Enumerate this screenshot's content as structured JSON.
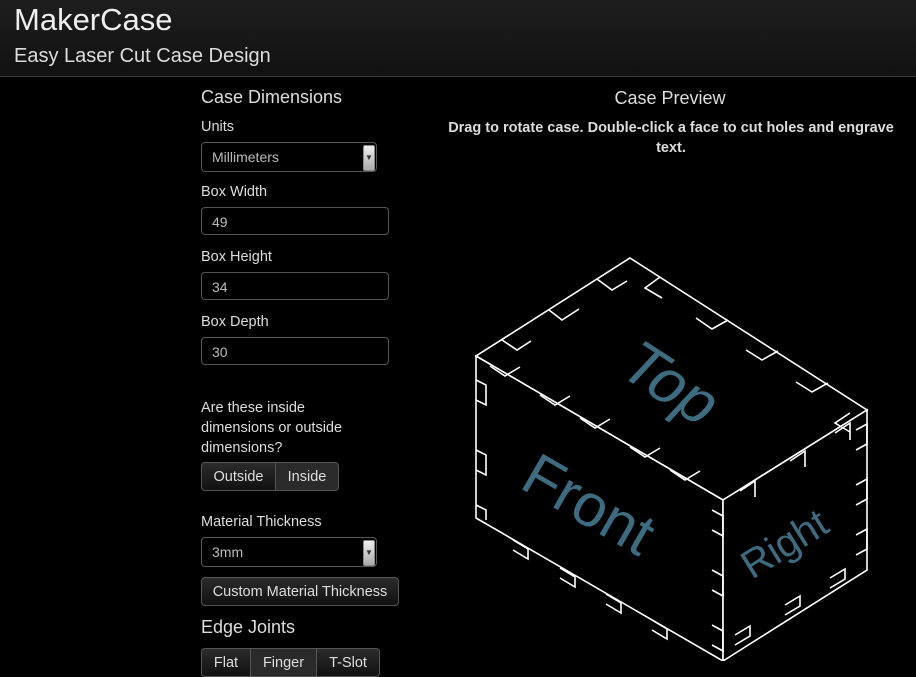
{
  "header": {
    "title": "MakerCase",
    "subtitle": "Easy Laser Cut Case Design"
  },
  "form": {
    "section_title": "Case Dimensions",
    "units_label": "Units",
    "units_value": "Millimeters",
    "width_label": "Box Width",
    "width_value": "49",
    "height_label": "Box Height",
    "height_value": "34",
    "depth_label": "Box Depth",
    "depth_value": "30",
    "inside_question": "Are these inside dimensions or outside dimensions?",
    "outside_label": "Outside",
    "inside_label": "Inside",
    "selected_dimension_mode": "Inside",
    "thickness_label": "Material Thickness",
    "thickness_value": "3mm",
    "custom_thickness_button": "Custom Material Thickness",
    "edge_joints_title": "Edge Joints",
    "joint_flat": "Flat",
    "joint_finger": "Finger",
    "joint_tslot": "T-Slot",
    "selected_joint": "Finger"
  },
  "preview": {
    "title": "Case Preview",
    "instructions": "Drag to rotate case. Double-click a face to cut holes and engrave text.",
    "face_top": "Top",
    "face_front": "Front",
    "face_right": "Right",
    "face_text_color": "#3d6b80"
  }
}
